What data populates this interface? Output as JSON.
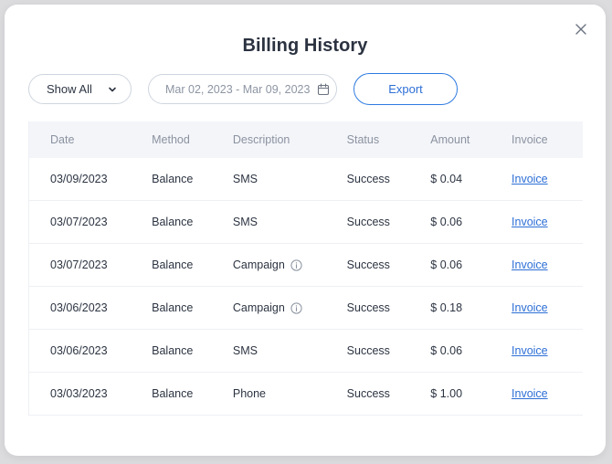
{
  "modal": {
    "title": "Billing History",
    "close_icon": "close-icon"
  },
  "filters": {
    "show_selected": "Show All",
    "date_range": "Mar 02, 2023 - Mar 09, 2023",
    "export_label": "Export"
  },
  "table": {
    "headers": {
      "date": "Date",
      "method": "Method",
      "description": "Description",
      "status": "Status",
      "amount": "Amount",
      "invoice": "Invoice"
    },
    "rows": [
      {
        "date": "03/09/2023",
        "method": "Balance",
        "description": "SMS",
        "info": false,
        "status": "Success",
        "amount": "$ 0.04",
        "invoice": "Invoice"
      },
      {
        "date": "03/07/2023",
        "method": "Balance",
        "description": "SMS",
        "info": false,
        "status": "Success",
        "amount": "$ 0.06",
        "invoice": "Invoice"
      },
      {
        "date": "03/07/2023",
        "method": "Balance",
        "description": "Campaign",
        "info": true,
        "status": "Success",
        "amount": "$ 0.06",
        "invoice": "Invoice"
      },
      {
        "date": "03/06/2023",
        "method": "Balance",
        "description": "Campaign",
        "info": true,
        "status": "Success",
        "amount": "$ 0.18",
        "invoice": "Invoice"
      },
      {
        "date": "03/06/2023",
        "method": "Balance",
        "description": "SMS",
        "info": false,
        "status": "Success",
        "amount": "$ 0.06",
        "invoice": "Invoice"
      },
      {
        "date": "03/03/2023",
        "method": "Balance",
        "description": "Phone",
        "info": false,
        "status": "Success",
        "amount": "$ 1.00",
        "invoice": "Invoice"
      }
    ]
  },
  "colors": {
    "accent": "#2d6fd6",
    "header_bg": "#f4f5f9"
  }
}
